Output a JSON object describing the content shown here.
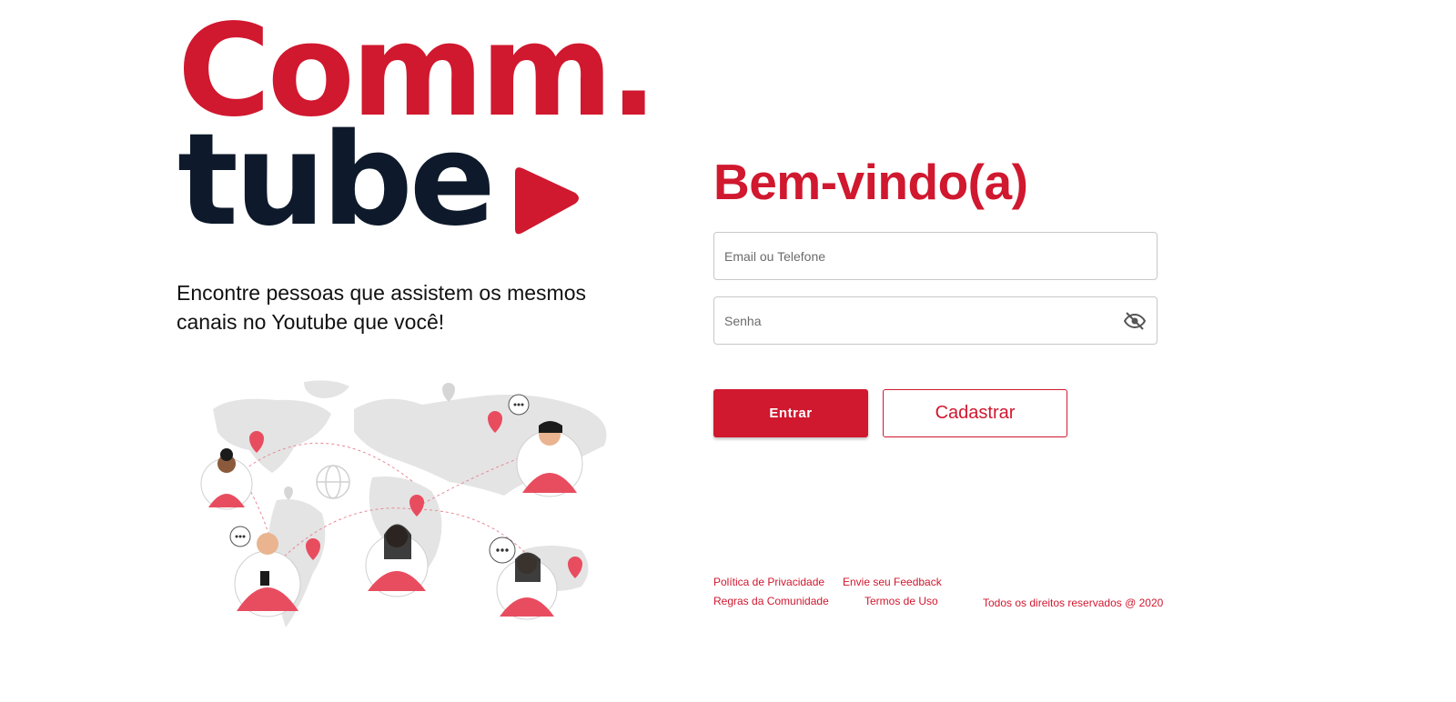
{
  "brand": {
    "line1": "Comm.",
    "line2": "tube",
    "colors": {
      "primary": "#d0182f",
      "dark": "#0e1a2b"
    },
    "play_icon": "play-triangle-icon"
  },
  "tagline": "Encontre pessoas que assistem os mesmos canais no Youtube que você!",
  "illustration": "world-map-people-illustration",
  "login": {
    "title": "Bem-vindo(a)",
    "email": {
      "placeholder": "Email ou Telefone",
      "value": ""
    },
    "password": {
      "placeholder": "Senha",
      "value": "",
      "toggle_icon": "eye-slash-icon"
    },
    "enter_label": "Entrar",
    "register_label": "Cadastrar"
  },
  "footer": {
    "privacy": "Política de Privacidade",
    "feedback": "Envie seu Feedback",
    "rules": "Regras da Comunidade",
    "terms": "Termos de Uso",
    "copyright": "Todos os direitos reservados @ 2020"
  }
}
